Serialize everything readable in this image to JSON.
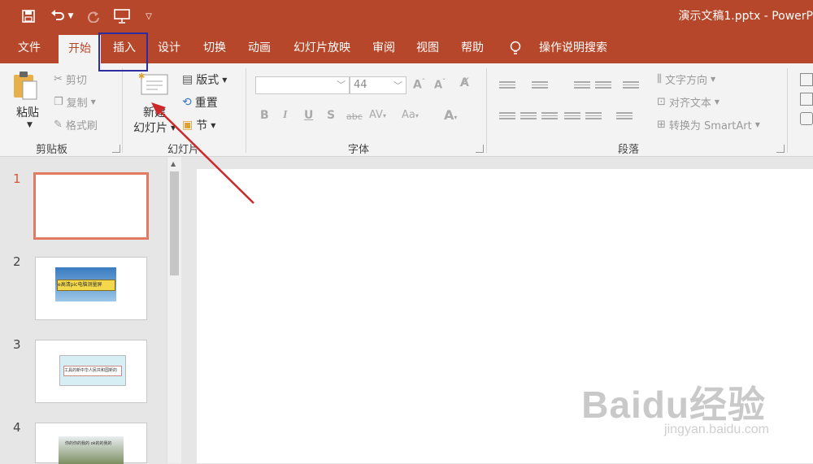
{
  "window": {
    "title": "演示文稿1.pptx  -  PowerP"
  },
  "tabs": [
    "文件",
    "开始",
    "插入",
    "设计",
    "切换",
    "动画",
    "幻灯片放映",
    "审阅",
    "视图",
    "帮助"
  ],
  "search_hint": "操作说明搜索",
  "ribbon": {
    "clipboard": {
      "paste": "粘贴",
      "cut": "剪切",
      "copy": "复制",
      "format_painter": "格式刷",
      "label": "剪贴板"
    },
    "slides": {
      "new_slide_line1": "新建",
      "new_slide_line2": "幻灯片",
      "layout": "版式",
      "reset": "重置",
      "section": "节",
      "label": "幻灯片"
    },
    "font": {
      "font_size": "44",
      "label": "字体"
    },
    "paragraph": {
      "text_direction": "文字方向",
      "align_text": "对齐文本",
      "convert_smartart": "转换为 SmartArt",
      "label": "段落"
    }
  },
  "thumbnails": [
    {
      "number": "1"
    },
    {
      "number": "2",
      "caption": "e高清pic电脑测量屏"
    },
    {
      "number": "3",
      "caption": "工具的新中华人民共和国新的"
    },
    {
      "number": "4",
      "caption": "你的你的我的 ok的的我的"
    }
  ],
  "watermark": {
    "brand": "Baidu经验",
    "url": "jingyan.baidu.com"
  },
  "colors": {
    "accent": "#b7472a",
    "highlight_box": "#2c2ca3",
    "arrow": "#cc2a2a"
  }
}
